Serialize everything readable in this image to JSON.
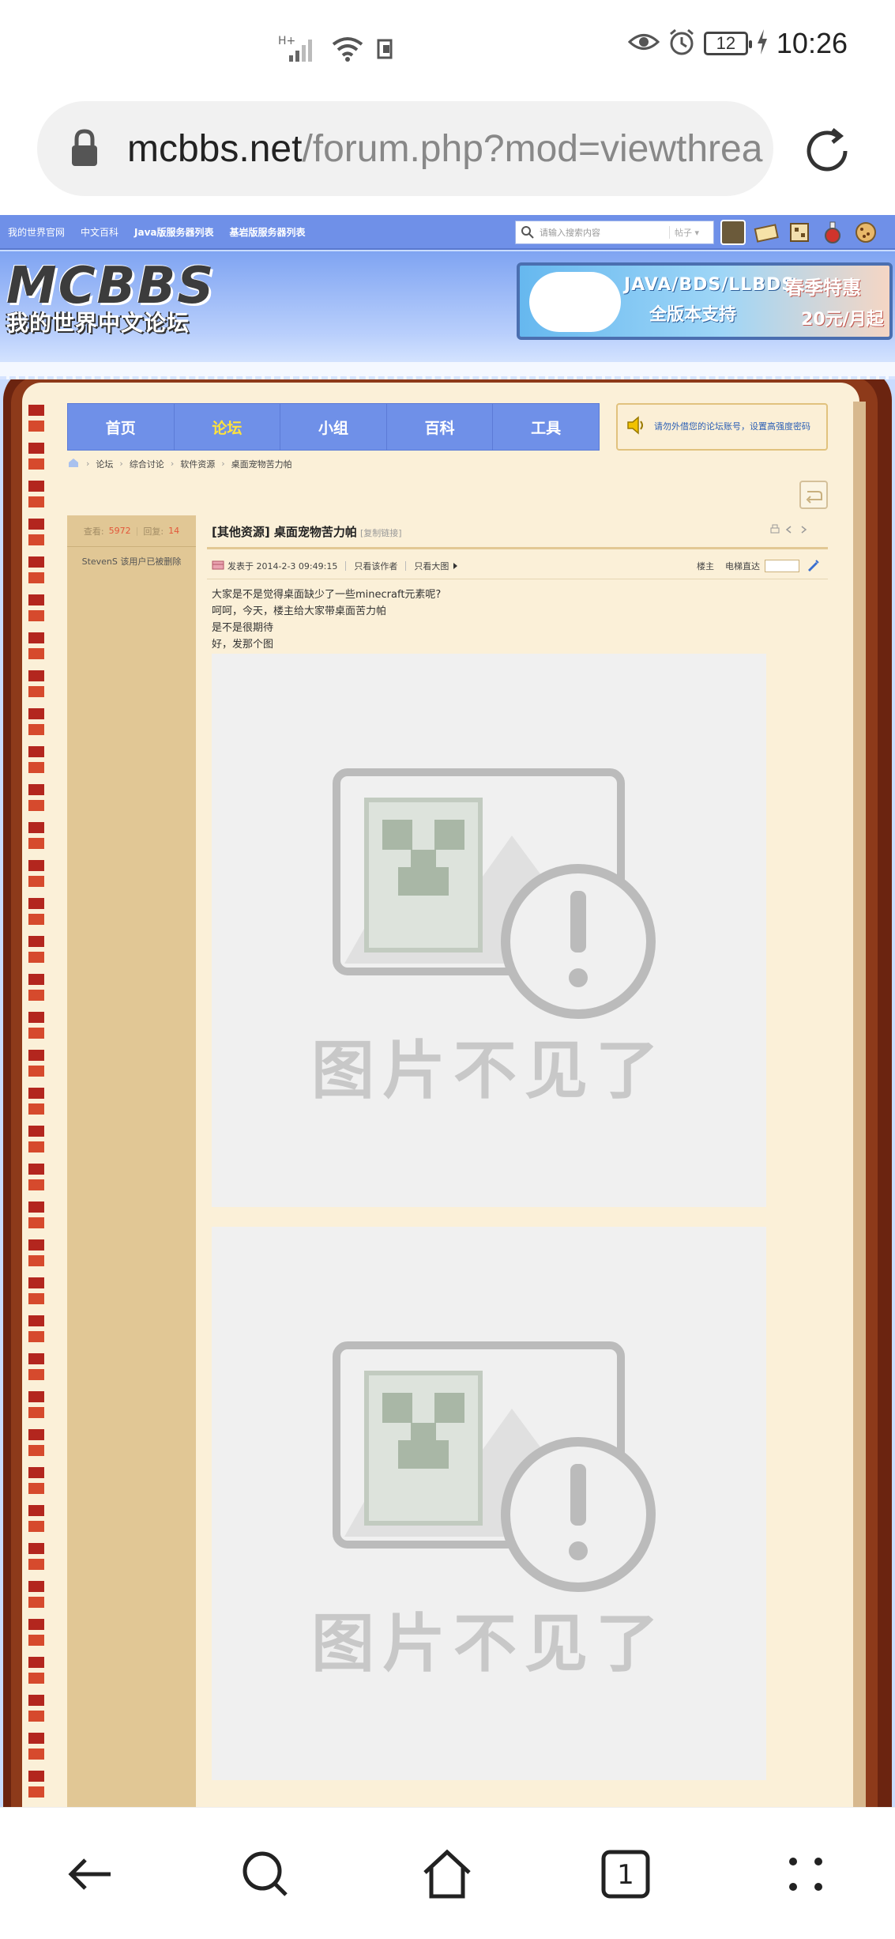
{
  "status_bar": {
    "time": "10:26",
    "battery": "12",
    "network_label": "H+",
    "icons": [
      "signal-icon",
      "wifi-icon",
      "sim-icon",
      "eye-icon",
      "alarm-icon",
      "battery-icon",
      "charging-icon"
    ]
  },
  "browser": {
    "url_host": "mcbbs.net",
    "url_path": "/forum.php?mod=viewthrea",
    "icons": [
      "lock-icon",
      "reload-icon"
    ]
  },
  "site": {
    "top_links": [
      "我的世界官网",
      "中文百科",
      "Java版服务器列表",
      "基岩版服务器列表"
    ],
    "search_placeholder": "请输入搜索内容",
    "search_scope": "帖子",
    "logo_text": "MCBBS",
    "logo_subtitle": "我的世界中文论坛",
    "banner": {
      "line1": "JAVA/BDS/LLBDS",
      "line2": "全版本支持",
      "promo1": "春季特惠",
      "promo2": "20元/月起"
    },
    "main_nav": [
      {
        "label": "首页",
        "active": false
      },
      {
        "label": "论坛",
        "active": true
      },
      {
        "label": "小组",
        "active": false
      },
      {
        "label": "百科",
        "active": false
      },
      {
        "label": "工具",
        "active": false
      }
    ],
    "notice": "请勿外借您的论坛账号，设置高强度密码",
    "breadcrumb": [
      "论坛",
      "综合讨论",
      "软件资源",
      "桌面宠物苦力帕"
    ]
  },
  "thread": {
    "views_label": "查看:",
    "views": "5972",
    "replies_label": "回复:",
    "replies": "14",
    "author": "StevenS 该用户已被删除",
    "title": "[其他资源] 桌面宠物苦力帕",
    "copy_link": "[复制链接]",
    "posted": "发表于 2014-2-3 09:49:15",
    "only_author": "只看该作者",
    "only_big_image": "只看大图",
    "floor": "楼主",
    "elevator": "电梯直达",
    "body_lines": [
      "大家是不是觉得桌面缺少了一些minecraft元素呢?",
      "呵呵，今天，楼主给大家带桌面苦力帕",
      "是不是很期待",
      "好，发那个图"
    ],
    "image_placeholder_text": "图片不见了"
  },
  "colors": {
    "nav_blue": "#6f90e8",
    "nav_active": "#ffe23c",
    "paper": "#fbf0d8",
    "side": "#e1c795",
    "frame": "#6b2410",
    "count_red": "#e3573a"
  }
}
